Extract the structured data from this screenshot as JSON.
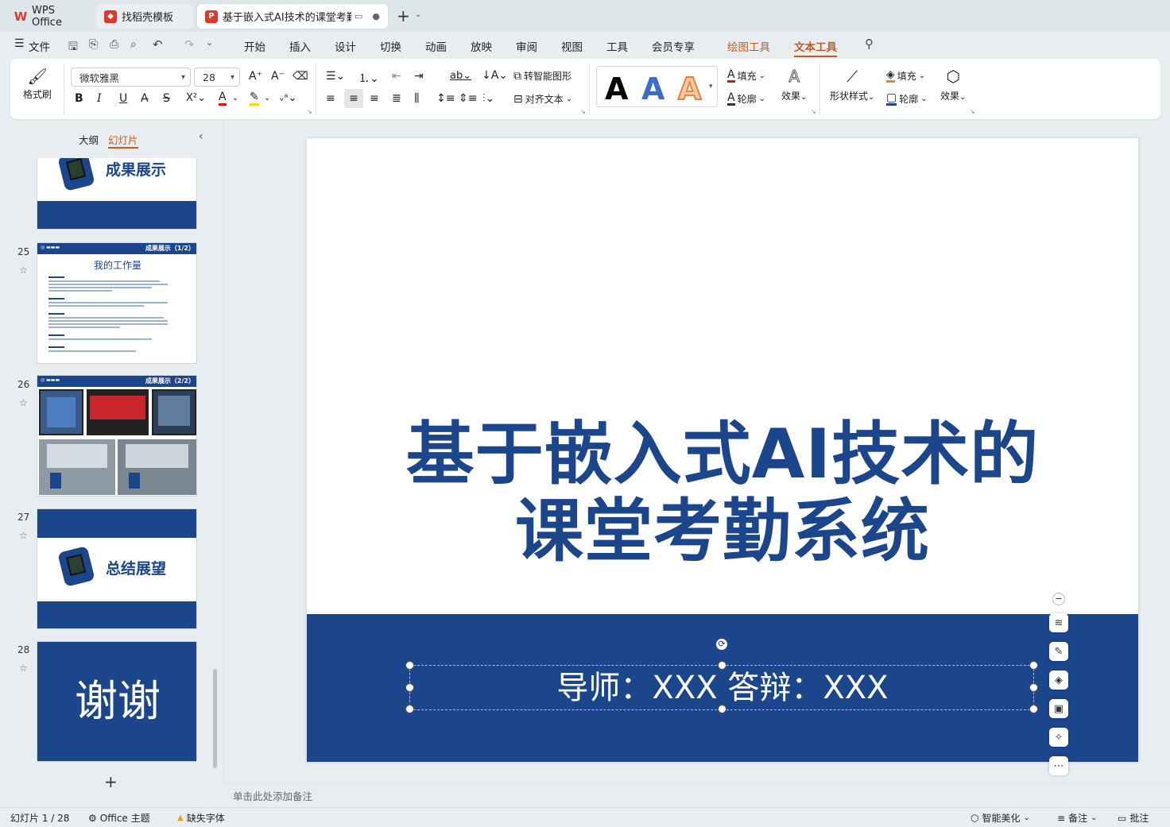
{
  "tabs": [
    {
      "label": "WPS Office",
      "icon": "wps-logo"
    },
    {
      "label": "找稻壳模板",
      "icon": "docer-logo"
    },
    {
      "label": "基于嵌入式AI技术的课堂考勤",
      "icon": "ppt-logo"
    }
  ],
  "menu": {
    "file": "文件",
    "items": [
      "开始",
      "插入",
      "设计",
      "切换",
      "动画",
      "放映",
      "审阅",
      "视图",
      "工具",
      "会员专享"
    ],
    "context_items": [
      "绘图工具",
      "文本工具"
    ]
  },
  "ribbon": {
    "format_painter": "格式刷",
    "font_name": "微软雅黑",
    "font_size": "28",
    "smart_shape": "转智能图形",
    "align_text": "对齐文本",
    "text_fill": "填充",
    "text_outline": "轮廓",
    "text_effect": "效果",
    "shape_style": "形状样式",
    "shape_fill": "填充",
    "shape_outline": "轮廓",
    "shape_effect": "效果",
    "style_letter": "A"
  },
  "panel": {
    "outline_tab": "大纲",
    "slides_tab": "幻灯片"
  },
  "thumbs": {
    "s24_title": "成果展示",
    "s25_num": "25",
    "s25_header": "成果展示（1/2）",
    "s25_title": "我的工作量",
    "s26_num": "26",
    "s26_header": "成果展示（2/2）",
    "s27_num": "27",
    "s27_title": "总结展望",
    "s28_num": "28",
    "s28_title": "谢谢"
  },
  "slide": {
    "title_line1": "基于嵌入式AI技术的",
    "title_line2": "课堂考勤系统",
    "subtitle": "导师：XXX  答辩：XXX"
  },
  "notes_placeholder": "单击此处添加备注",
  "status": {
    "slide_counter": "幻灯片 1 / 28",
    "theme": "Office 主题",
    "missing_font": "缺失字体",
    "smart_beautify": "智能美化",
    "notes": "备注",
    "comments": "批注"
  },
  "colors": {
    "brand_blue": "#1c468c",
    "context_orange": "#c45a1d",
    "wps_red": "#e2362d"
  }
}
